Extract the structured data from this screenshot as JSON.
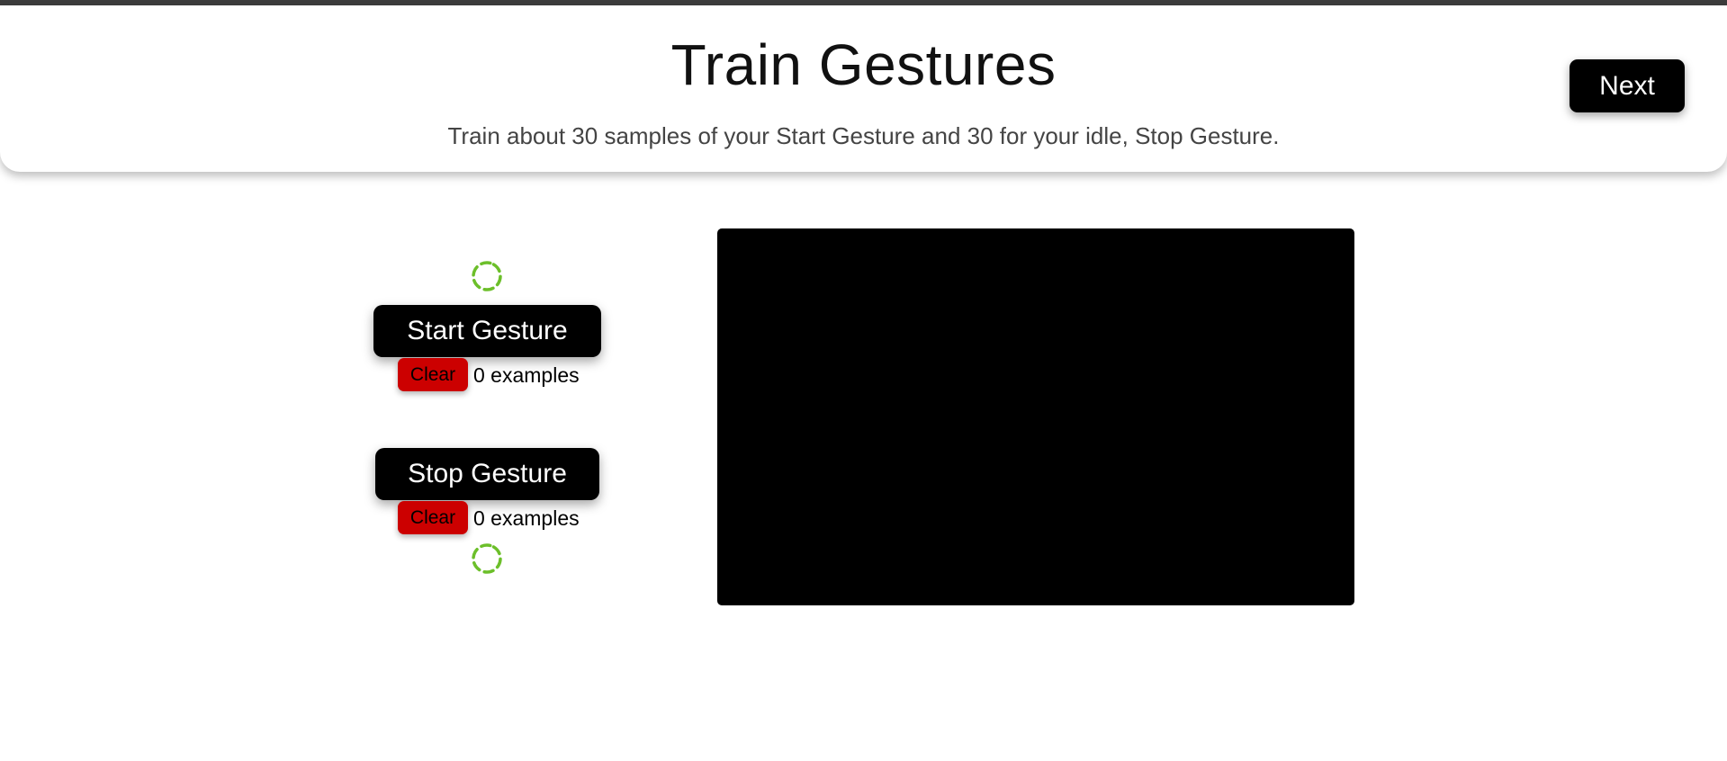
{
  "header": {
    "title": "Train Gestures",
    "subtitle": "Train about 30 samples of your Start Gesture and 30 for your idle, Stop Gesture.",
    "next_label": "Next"
  },
  "gestures": [
    {
      "label": "Start Gesture",
      "clear_label": "Clear",
      "count_text": "0 examples"
    },
    {
      "label": "Stop Gesture",
      "clear_label": "Clear",
      "count_text": "0 examples"
    }
  ],
  "icons": {
    "loading": "loading-spinner-icon"
  },
  "colors": {
    "primary_button": "#000000",
    "clear_button": "#cc0000",
    "spinner": "#6cbf2a",
    "video_background": "#000000"
  }
}
